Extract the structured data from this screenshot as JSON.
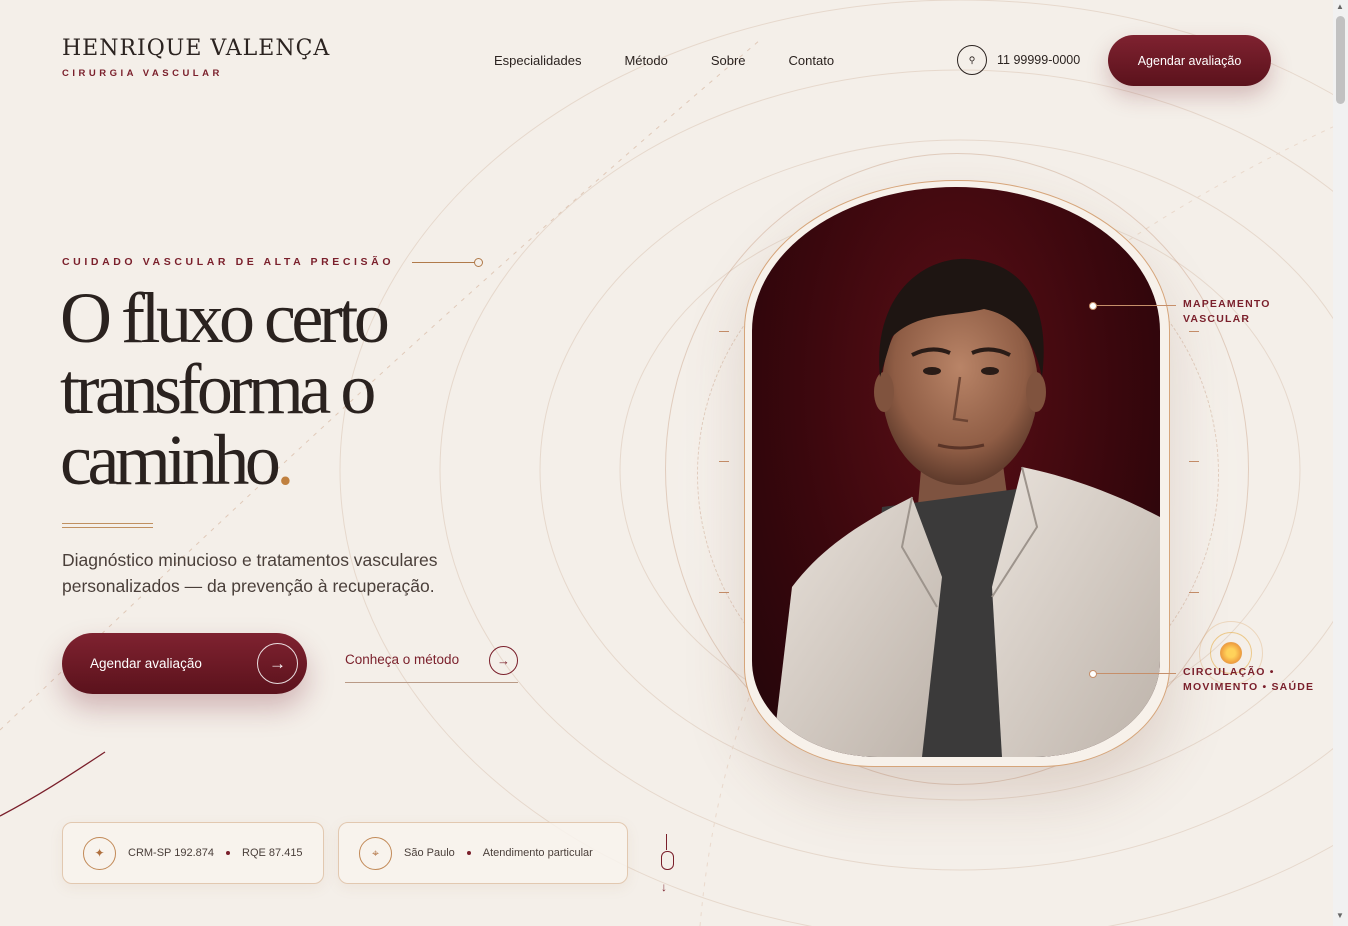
{
  "brand": {
    "name": "HENRIQUE VALENÇA",
    "subtitle": "CIRURGIA VASCULAR"
  },
  "nav": {
    "items": [
      {
        "label": "Especialidades"
      },
      {
        "label": "Método"
      },
      {
        "label": "Sobre"
      },
      {
        "label": "Contato"
      }
    ]
  },
  "header": {
    "phone": "11 99999-0000",
    "phone_icon": "pin-icon",
    "cta_label": "Agendar avaliação"
  },
  "hero": {
    "eyebrow": "CUIDADO VASCULAR DE ALTA PRECISÃO",
    "headline_line1": "O fluxo certo",
    "headline_line2": "transforma o",
    "headline_line3": "caminho",
    "headline_dot": ".",
    "lead": "Diagnóstico minucioso e tratamentos vasculares personalizados — da prevenção à recuperação.",
    "primary_cta": "Agendar avaliação",
    "secondary_cta": "Conheça o método",
    "arrow_glyph": "→"
  },
  "credentials": {
    "card1": {
      "icon": "sparkle-icon",
      "crm": "CRM-SP 192.874",
      "rqe": "RQE 87.415"
    },
    "card2": {
      "icon": "location-icon",
      "city": "São Paulo",
      "type": "Atendimento particular"
    }
  },
  "annotations": {
    "mapping_line1": "MAPEAMENTO",
    "mapping_line2": "VASCULAR",
    "circulation_line1": "CIRCULAÇÃO •",
    "circulation_line2": "MOVIMENTO • SAÚDE"
  },
  "colors": {
    "background": "#f4efe9",
    "brand_burgundy": "#7a1f2b",
    "accent_bronze": "#c0803f",
    "text_dark": "#2b2320"
  }
}
